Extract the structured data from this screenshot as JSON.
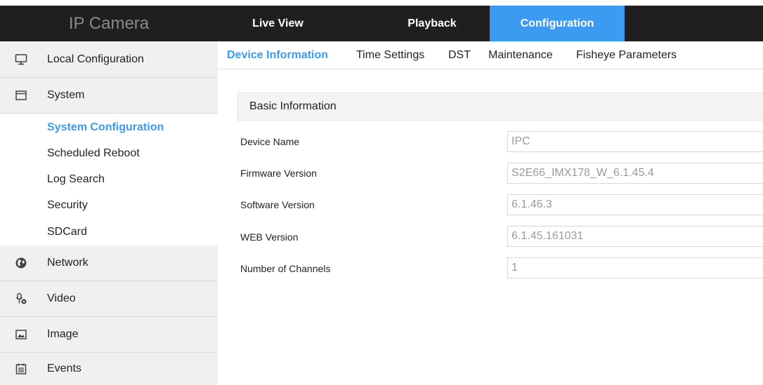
{
  "header": {
    "brand": "IP Camera",
    "nav": [
      {
        "label": "Live View"
      },
      {
        "label": "Playback"
      },
      {
        "label": "Configuration"
      }
    ]
  },
  "sidebar": {
    "local_configuration": {
      "label": "Local Configuration",
      "icon": "monitor-icon"
    },
    "system": {
      "label": "System",
      "icon": "window-icon",
      "items": [
        {
          "label": "System Configuration"
        },
        {
          "label": "Scheduled Reboot"
        },
        {
          "label": "Log Search"
        },
        {
          "label": "Security"
        },
        {
          "label": "SDCard"
        }
      ]
    },
    "network": {
      "label": "Network",
      "icon": "globe-icon"
    },
    "video": {
      "label": "Video",
      "icon": "microphone-camera-icon"
    },
    "image": {
      "label": "Image",
      "icon": "image-icon"
    },
    "events": {
      "label": "Events",
      "icon": "calendar-icon"
    }
  },
  "tabs": [
    {
      "label": "Device Information"
    },
    {
      "label": "Time Settings"
    },
    {
      "label": "DST"
    },
    {
      "label": "Maintenance"
    },
    {
      "label": "Fisheye Parameters"
    }
  ],
  "basic_information": {
    "title": "Basic Information",
    "fields": [
      {
        "label": "Device Name",
        "value": "IPC"
      },
      {
        "label": "Firmware Version",
        "value": "S2E66_IMX178_W_6.1.45.4"
      },
      {
        "label": "Software Version",
        "value": "6.1.46.3"
      },
      {
        "label": "WEB Version",
        "value": "6.1.45.161031"
      },
      {
        "label": "Number of Channels",
        "value": "1"
      }
    ]
  },
  "colors": {
    "accent": "#3c9bf0",
    "topbar": "#1f1f1f",
    "sidebar_group_bg": "#f0f0f0"
  }
}
